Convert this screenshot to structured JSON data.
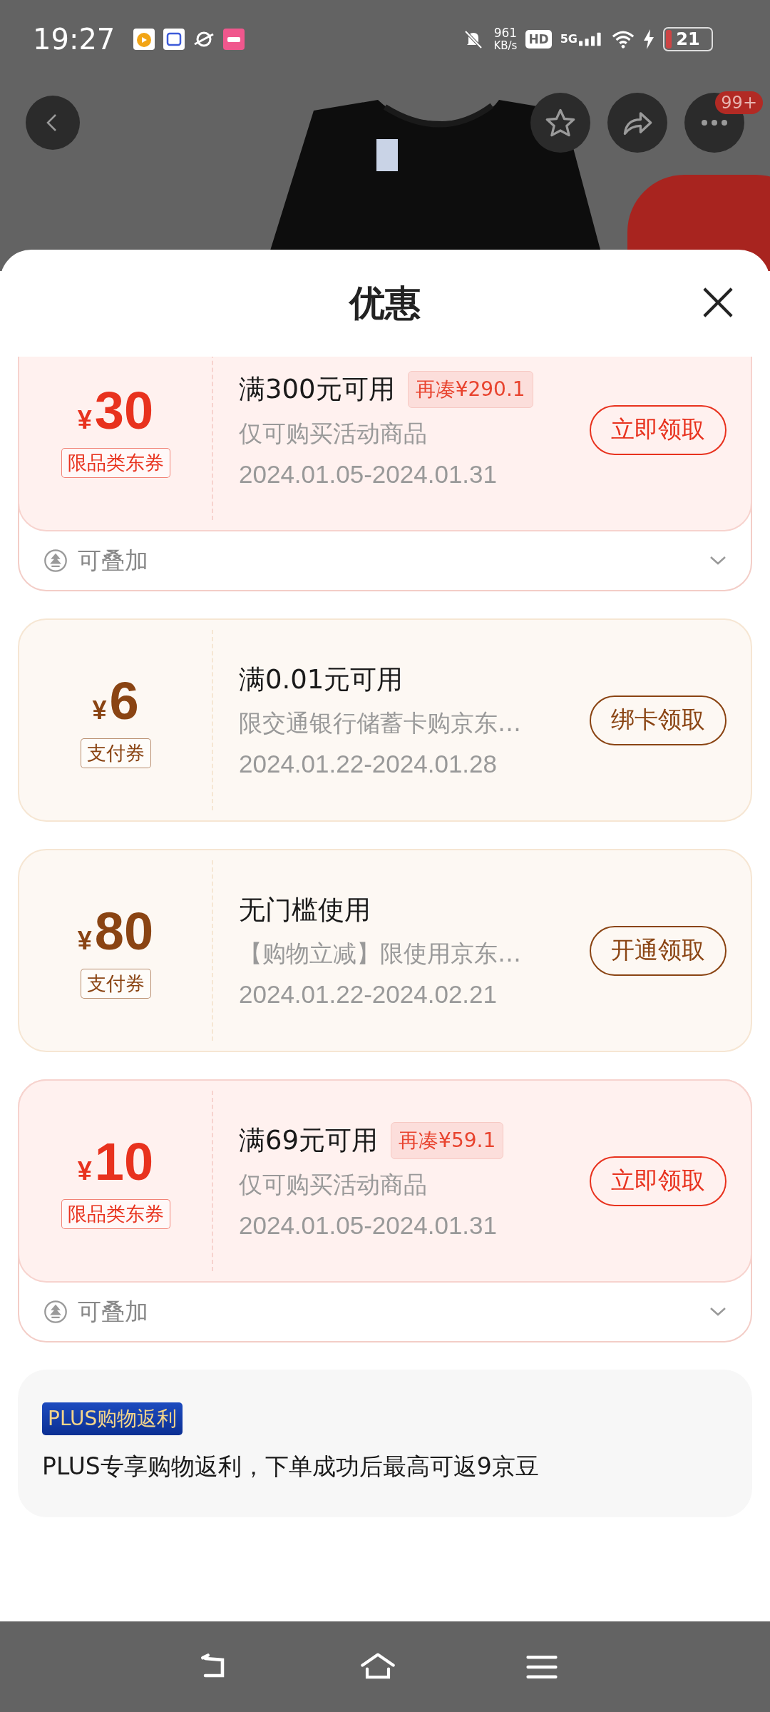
{
  "status_bar": {
    "time": "19:27",
    "network_speed": "961",
    "speed_unit": "KB/s",
    "hd": "HD",
    "network": "5G",
    "battery": "21"
  },
  "top_actions": {
    "more_badge": "99+"
  },
  "sheet": {
    "title": "优惠"
  },
  "coupons": [
    {
      "kind": "store",
      "currency": "¥",
      "amount": "30",
      "tag": "限品类东券",
      "condition": "满300元可用",
      "gap": "再凑¥290.1",
      "note": "仅可购买活动商品",
      "validity": "2024.01.05-2024.01.31",
      "button": "立即领取",
      "stack_label": "可叠加"
    },
    {
      "kind": "payment",
      "currency": "¥",
      "amount": "6",
      "tag": "支付券",
      "condition": "满0.01元可用",
      "note": "限交通银行储蓄卡购京东…",
      "validity": "2024.01.22-2024.01.28",
      "button": "绑卡领取"
    },
    {
      "kind": "payment",
      "currency": "¥",
      "amount": "80",
      "tag": "支付券",
      "condition": "无门槛使用",
      "note": "【购物立减】限使用京东…",
      "validity": "2024.01.22-2024.02.21",
      "button": "开通领取"
    },
    {
      "kind": "store",
      "currency": "¥",
      "amount": "10",
      "tag": "限品类东券",
      "condition": "满69元可用",
      "gap": "再凑¥59.1",
      "note": "仅可购买活动商品",
      "validity": "2024.01.05-2024.01.31",
      "button": "立即领取",
      "stack_label": "可叠加"
    }
  ],
  "plus": {
    "badge": "PLUS购物返利",
    "text": "PLUS专享购物返利，下单成功后最高可返9京豆"
  }
}
